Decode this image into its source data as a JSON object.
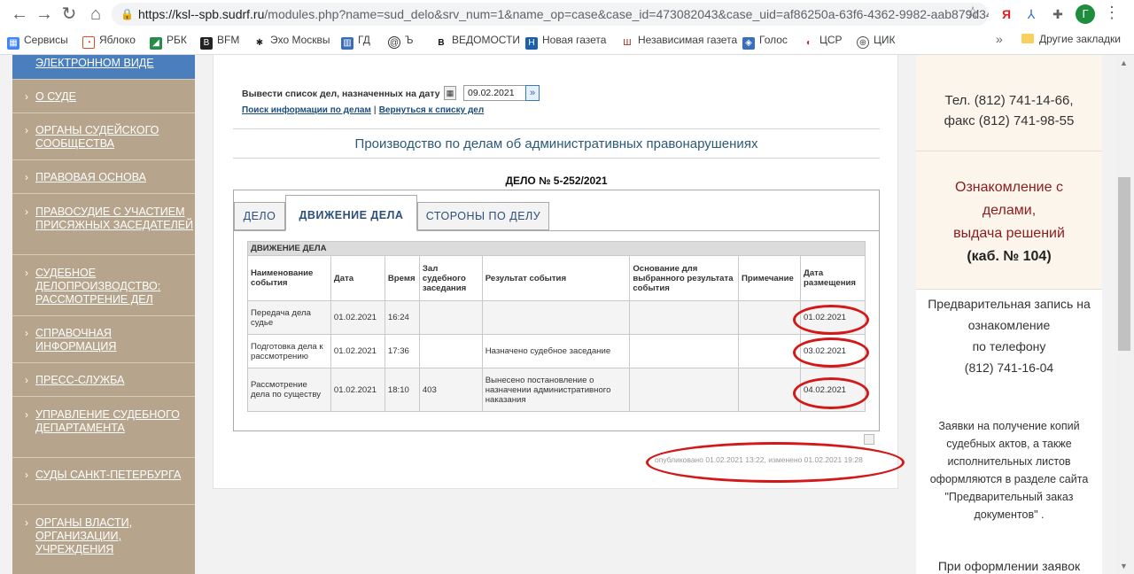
{
  "browser": {
    "url_host": "https://ksl--spb.sudrf.ru",
    "url_rest": "/modules.php?name=sud_delo&srv_num=1&name_op=case&case_id=473082043&case_uid=af86250a-63f6-4362-9982-aab879d349...",
    "profile_initial": "Г",
    "bookmarks": [
      "Сервисы",
      "Яблоко",
      "РБК",
      "BFM",
      "Эхо Москвы",
      "ГД",
      "Ъ",
      "ВЕДОМОСТИ",
      "Новая газета",
      "Независимая газета",
      "Голос",
      "ЦСР",
      "ЦИК"
    ],
    "more": "»",
    "other_bookmarks": "Другие закладки"
  },
  "sidebar": {
    "items": [
      "ЭЛЕКТРОННОМ ВИДЕ",
      "О СУДЕ",
      "ОРГАНЫ СУДЕЙСКОГО СООБЩЕСТВА",
      "ПРАВОВАЯ ОСНОВА",
      "ПРАВОСУДИЕ С УЧАСТИЕМ ПРИСЯЖНЫХ ЗАСЕДАТЕЛЕЙ",
      "СУДЕБНОЕ ДЕЛОПРОИЗВОДСТВО: РАССМОТРЕНИЕ ДЕЛ",
      "СПРАВОЧНАЯ ИНФОРМАЦИЯ",
      "ПРЕСС-СЛУЖБА",
      "УПРАВЛЕНИЕ СУДЕБНОГО ДЕПАРТАМЕНТА",
      "СУДЫ САНКТ-ПЕТЕРБУРГА",
      "ОРГАНЫ ВЛАСТИ, ОРГАНИЗАЦИИ, УЧРЕЖДЕНИЯ"
    ]
  },
  "main": {
    "date_label": "Вывести список дел, назначенных на дату",
    "date_value": "09.02.2021",
    "link_search": "Поиск информации по делам",
    "link_sep": "|",
    "link_back": "Вернуться к списку дел",
    "section_title": "Производство по делам об административных правонарушениях",
    "case_number": "ДЕЛО № 5-252/2021",
    "tabs": [
      "ДЕЛО",
      "ДВИЖЕНИЕ ДЕЛА",
      "СТОРОНЫ ПО ДЕЛУ"
    ],
    "table_caption": "ДВИЖЕНИЕ ДЕЛА",
    "columns": [
      "Наименование события",
      "Дата",
      "Время",
      "Зал судебного заседания",
      "Результат события",
      "Основание для выбранного результата события",
      "Примечание",
      "Дата размещения"
    ],
    "rows": [
      [
        "Передача дела судье",
        "01.02.2021",
        "16:24",
        "",
        "",
        "",
        "",
        "01.02.2021"
      ],
      [
        "Подготовка дела к рассмотрению",
        "01.02.2021",
        "17:36",
        "",
        "Назначено судебное заседание",
        "",
        "",
        "03.02.2021"
      ],
      [
        "Рассмотрение дела по существу",
        "01.02.2021",
        "18:10",
        "403",
        "Вынесено постановление о назначении административного наказания",
        "",
        "",
        "04.02.2021"
      ]
    ],
    "published": "опубликовано 01.02.2021 13:22, изменено 01.02.2021 19:28"
  },
  "right": {
    "phone": "Тел. (812) 741-14-66,",
    "fax": "факс (812) 741-98-55",
    "notice_line1": "Ознакомление с",
    "notice_line2": "делами,",
    "notice_line3": "выдача решений",
    "notice_line4": "(каб. № 104)",
    "prereg1": "Предварительная запись на",
    "prereg2": "ознакомление",
    "prereg3": "по  телефону",
    "prereg4": "(812) 741-16-04",
    "copies1": "Заявки на получение копий",
    "copies2": "судебных актов, а также",
    "copies3": "исполнительных листов",
    "copies4": "оформляются в разделе сайта",
    "copies5": "\"Предварительный заказ",
    "copies6": "документов\" .",
    "apply": "При оформлении  заявок"
  },
  "colors": {
    "sidebar_bg": "#b6a48c",
    "sidebar_active": "#4a7ebc",
    "annotation_red": "#d21818",
    "right_text_red": "#8a1c1c"
  }
}
